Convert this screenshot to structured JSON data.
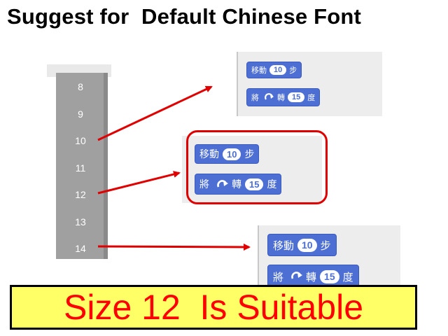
{
  "title": "Suggest for  Default Chinese Font",
  "font_sizes": [
    "8",
    "9",
    "10",
    "11",
    "12",
    "13",
    "14"
  ],
  "blocks": {
    "move_prefix": "移動",
    "move_steps": "10",
    "move_suffix": "步",
    "turn_prefix": "將",
    "turn_verb": "轉",
    "turn_degrees": "15",
    "turn_suffix": "度"
  },
  "banner": "Size 12  Is Suitable",
  "colors": {
    "block_blue": "#4d6fd4",
    "arrow_red": "#e00000",
    "banner_yellow": "#ffff66",
    "banner_text_red": "#ff0000",
    "list_gray": "#a0a0a0"
  },
  "icons": {
    "rotate": "rotate-clockwise-icon"
  }
}
